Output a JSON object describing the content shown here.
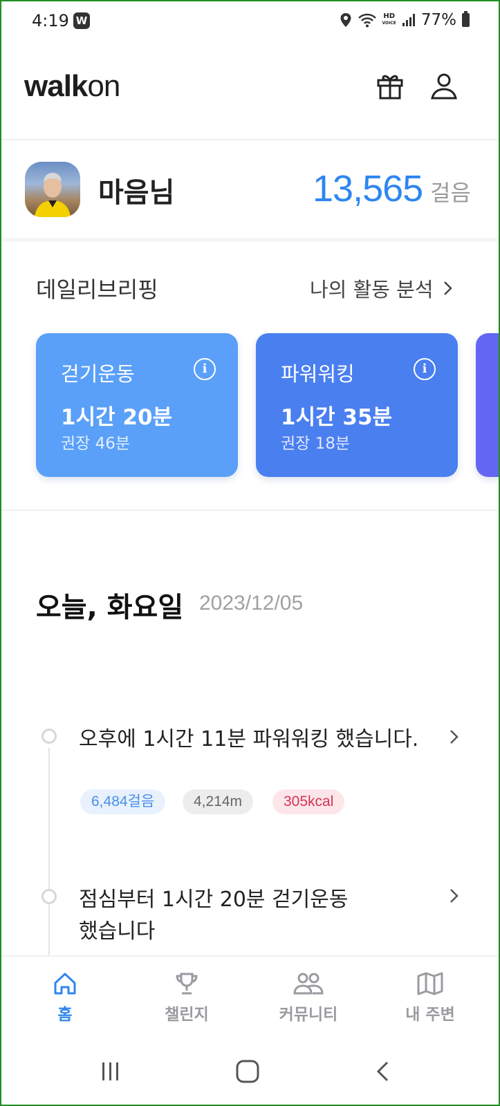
{
  "status_bar": {
    "time": "4:19",
    "app_badge": "W",
    "hd_top": "HD",
    "hd_bottom": "VOICE",
    "battery": "77%"
  },
  "header": {
    "logo_walk": "walk",
    "logo_on": "on"
  },
  "profile": {
    "name": "마음님",
    "steps": "13,565",
    "steps_unit": "걸음"
  },
  "briefing": {
    "title": "데일리브리핑",
    "link": "나의 활동 분석",
    "cards": [
      {
        "title": "걷기운동",
        "value": "1시간 20분",
        "recommended": "권장 46분",
        "color": "#5aa0f8"
      },
      {
        "title": "파워워킹",
        "value": "1시간 35분",
        "recommended": "권장 18분",
        "color": "#4a7ff0"
      }
    ]
  },
  "today": {
    "title": "오늘, 화요일",
    "date": "2023/12/05"
  },
  "activities": [
    {
      "text": "오후에 1시간 11분 파워워킹 했습니다.",
      "steps": "6,484걸음",
      "distance": "4,214m",
      "kcal": "305kcal"
    },
    {
      "text_line1": "점심부터 1시간 20분 걷기운동",
      "text_line2": "했습니다"
    }
  ],
  "nav": [
    {
      "label": "홈",
      "active": true
    },
    {
      "label": "챌린지",
      "active": false
    },
    {
      "label": "커뮤니티",
      "active": false
    },
    {
      "label": "내 주변",
      "active": false
    }
  ],
  "colors": {
    "accent": "#2f86f0",
    "nav_inactive": "#9a9aa0",
    "nav_active": "#2f86f0"
  }
}
